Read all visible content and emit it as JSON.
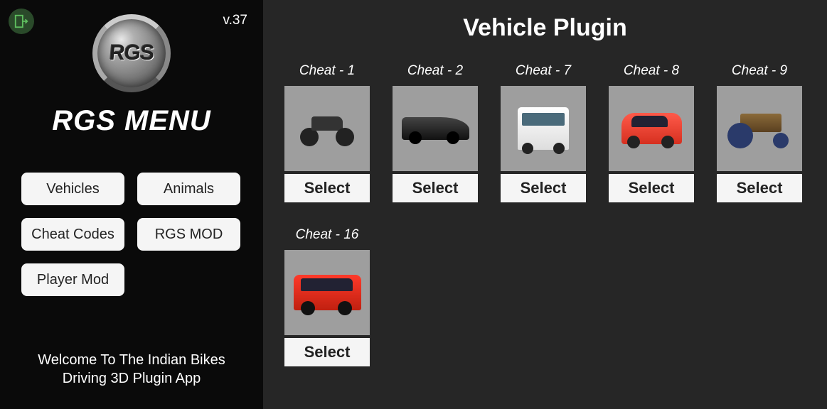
{
  "sidebar": {
    "version": "v.37",
    "logo_text": "RGS",
    "title": "RGS MENU",
    "buttons": {
      "vehicles": "Vehicles",
      "animals": "Animals",
      "cheat_codes": "Cheat Codes",
      "rgs_mod": "RGS MOD",
      "player_mod": "Player Mod"
    },
    "welcome": "Welcome To The Indian Bikes Driving 3D Plugin App"
  },
  "main": {
    "title": "Vehicle Plugin",
    "select_label": "Select",
    "vehicles": [
      {
        "label": "Cheat - 1",
        "icon": "motorcycle"
      },
      {
        "label": "Cheat - 2",
        "icon": "sports-car"
      },
      {
        "label": "Cheat - 7",
        "icon": "van"
      },
      {
        "label": "Cheat - 8",
        "icon": "hatchback"
      },
      {
        "label": "Cheat - 9",
        "icon": "tractor"
      },
      {
        "label": "Cheat - 16",
        "icon": "suv"
      }
    ]
  }
}
